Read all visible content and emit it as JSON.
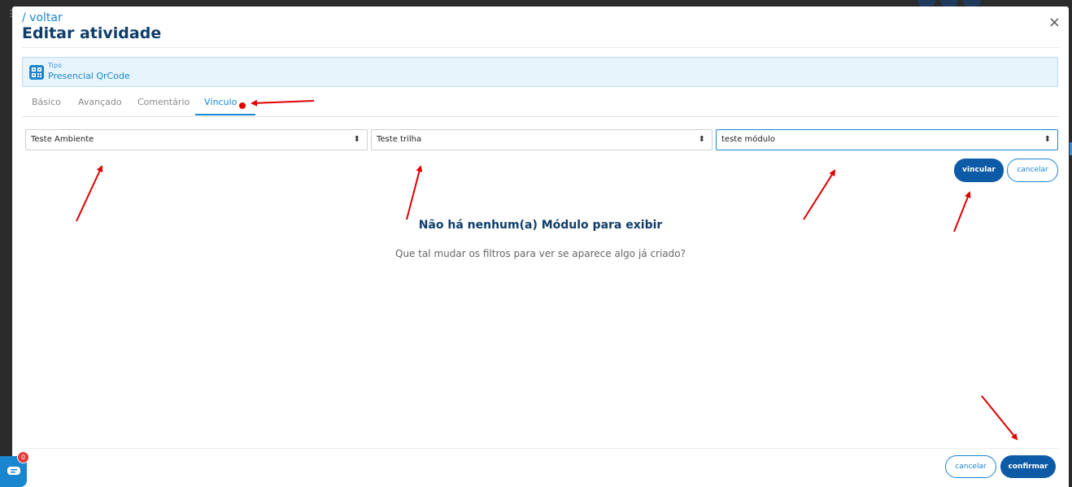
{
  "modal": {
    "back_label": "/ voltar",
    "title": "Editar atividade",
    "close_icon": "×"
  },
  "activity_type": {
    "label": "Tipo",
    "value": "Presencial QrCode",
    "icon": "qrcode-icon"
  },
  "tabs": [
    {
      "label": "Básico",
      "active": false
    },
    {
      "label": "Avançado",
      "active": false
    },
    {
      "label": "Comentário",
      "active": false
    },
    {
      "label": "Vínculo",
      "active": true
    }
  ],
  "filters": {
    "ambiente": "Teste Ambiente",
    "trilha": "Teste trilha",
    "modulo": "teste módulo"
  },
  "link_actions": {
    "link_label": "vincular",
    "cancel_label": "cancelar"
  },
  "empty_state": {
    "title": "Não há nenhum(a) Módulo para exibir",
    "subtitle": "Que tal mudar os filtros para ver se aparece algo já criado?"
  },
  "footer": {
    "cancel_label": "cancelar",
    "confirm_label": "confirmar"
  },
  "chat": {
    "badge_count": "0"
  },
  "colors": {
    "primary": "#0d5aa7",
    "accent": "#1a86d0",
    "annotation": "#e00000",
    "title": "#0f3d6b"
  }
}
